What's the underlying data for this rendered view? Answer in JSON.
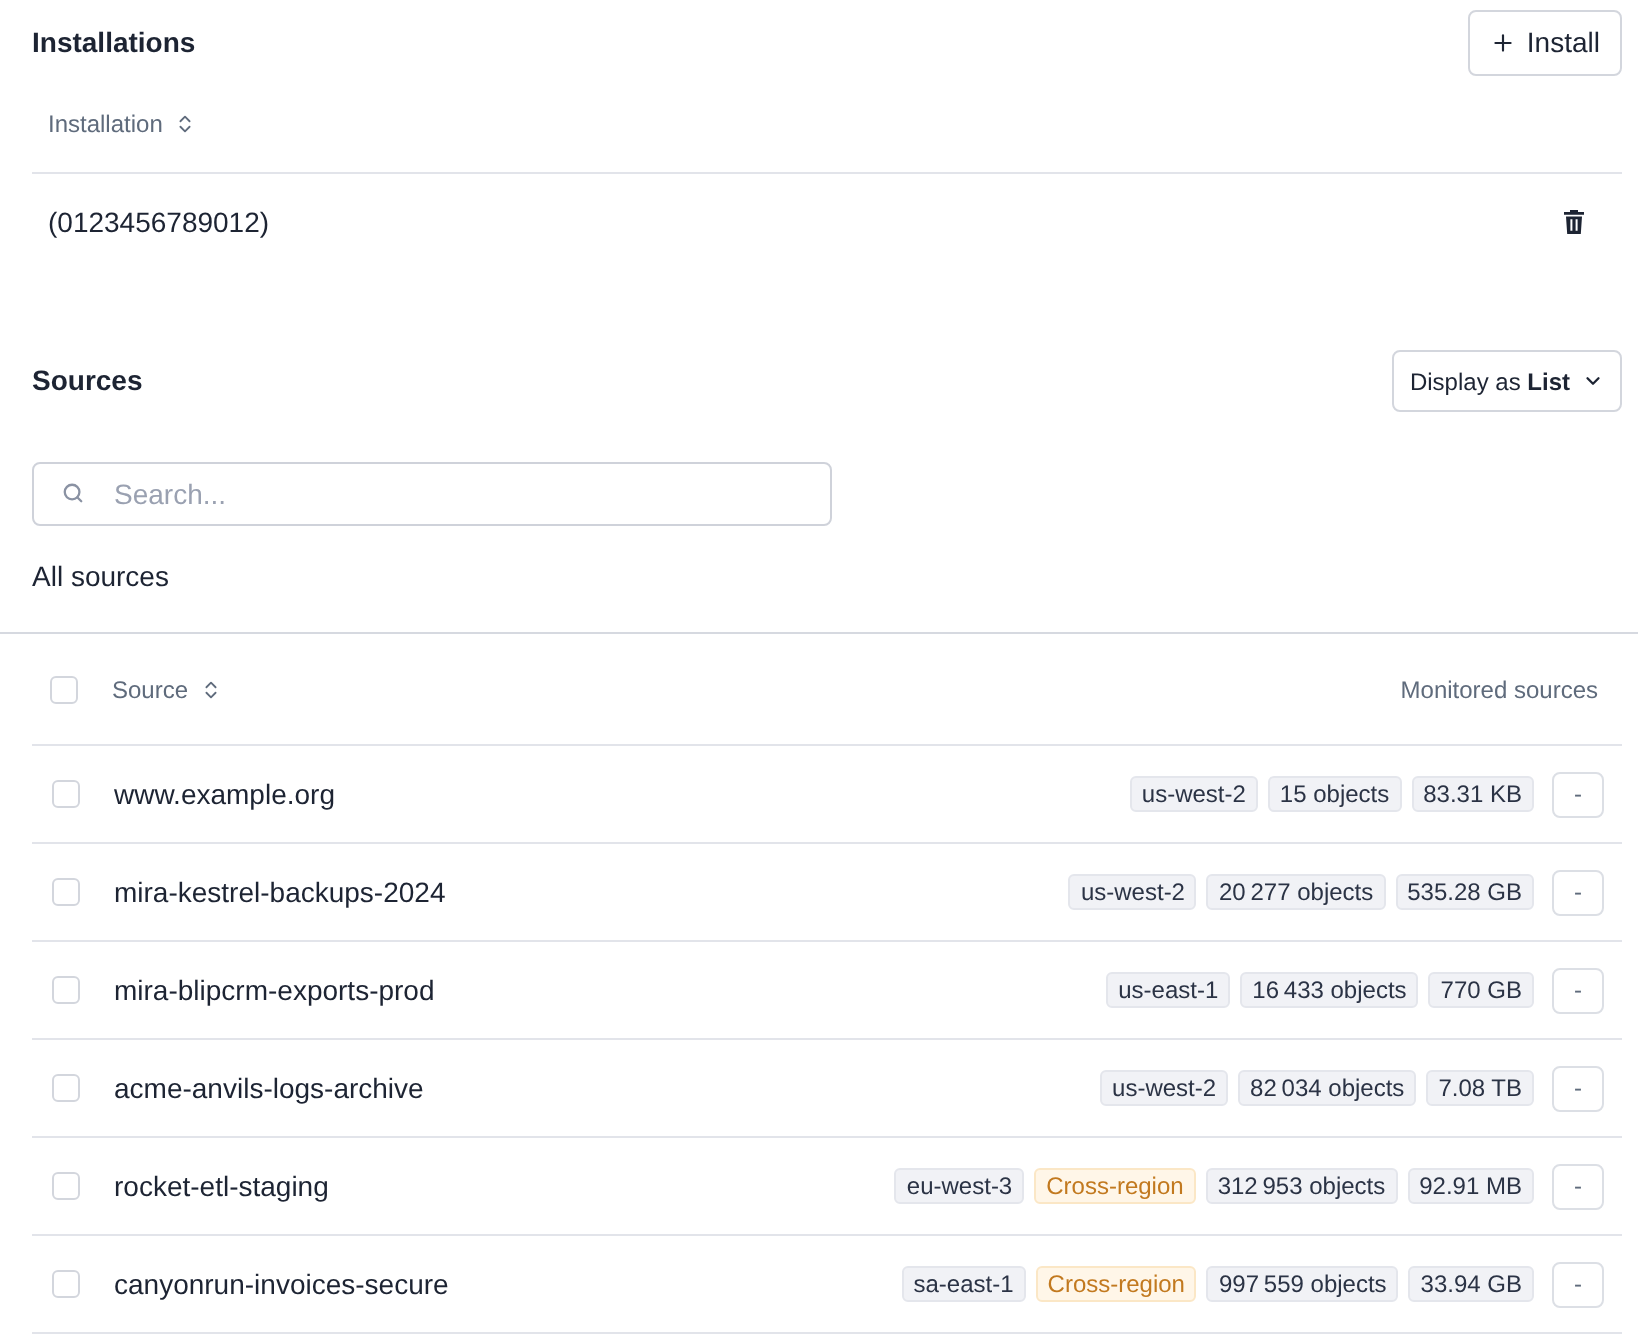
{
  "installations": {
    "title": "Installations",
    "install_button": {
      "label": "Install"
    },
    "table": {
      "column": "Installation",
      "rows": [
        {
          "name": "(0123456789012)"
        }
      ]
    }
  },
  "sources": {
    "title": "Sources",
    "display_button": {
      "label": "Display as **List**"
    },
    "search": {
      "placeholder": "Search..."
    },
    "filter": "All sources",
    "table": {
      "columns": [
        {
          "label": "Source"
        },
        {
          "label": "Monitored sources"
        }
      ],
      "select_all": {
        "checked": false
      },
      "rows": [
        {
          "name": "www.example.org",
          "checked": false,
          "tags": [
            {
              "kind": "neutral",
              "text": "us-west-2"
            },
            {
              "kind": "neutral",
              "text": "15 objects"
            },
            {
              "kind": "neutral",
              "text": "83.31 KB"
            }
          ],
          "action": "-"
        },
        {
          "name": "mira-kestrel-backups-2024",
          "checked": false,
          "tags": [
            {
              "kind": "neutral",
              "text": "us-west-2"
            },
            {
              "kind": "neutral",
              "text": "20 277 objects"
            },
            {
              "kind": "neutral",
              "text": "535.28 GB"
            }
          ],
          "action": "-"
        },
        {
          "name": "mira-blipcrm-exports-prod",
          "checked": false,
          "tags": [
            {
              "kind": "neutral",
              "text": "us-east-1"
            },
            {
              "kind": "neutral",
              "text": "16 433 objects"
            },
            {
              "kind": "neutral",
              "text": "770 GB"
            }
          ],
          "action": "-"
        },
        {
          "name": "acme-anvils-logs-archive",
          "checked": false,
          "tags": [
            {
              "kind": "neutral",
              "text": "us-west-2"
            },
            {
              "kind": "neutral",
              "text": "82 034 objects"
            },
            {
              "kind": "neutral",
              "text": "7.08 TB"
            }
          ],
          "action": "-"
        },
        {
          "name": "rocket-etl-staging",
          "checked": false,
          "tags": [
            {
              "kind": "neutral",
              "text": "eu-west-3"
            },
            {
              "kind": "warning",
              "text": "Cross-region"
            },
            {
              "kind": "neutral",
              "text": "312 953 objects"
            },
            {
              "kind": "neutral",
              "text": "92.91 MB"
            }
          ],
          "action": "-"
        },
        {
          "name": "canyonrun-invoices-secure",
          "checked": false,
          "tags": [
            {
              "kind": "neutral",
              "text": "sa-east-1"
            },
            {
              "kind": "warning",
              "text": "Cross-region"
            },
            {
              "kind": "neutral",
              "text": "997 559 objects"
            },
            {
              "kind": "neutral",
              "text": "33.94 GB"
            }
          ],
          "action": "-"
        }
      ]
    }
  }
}
